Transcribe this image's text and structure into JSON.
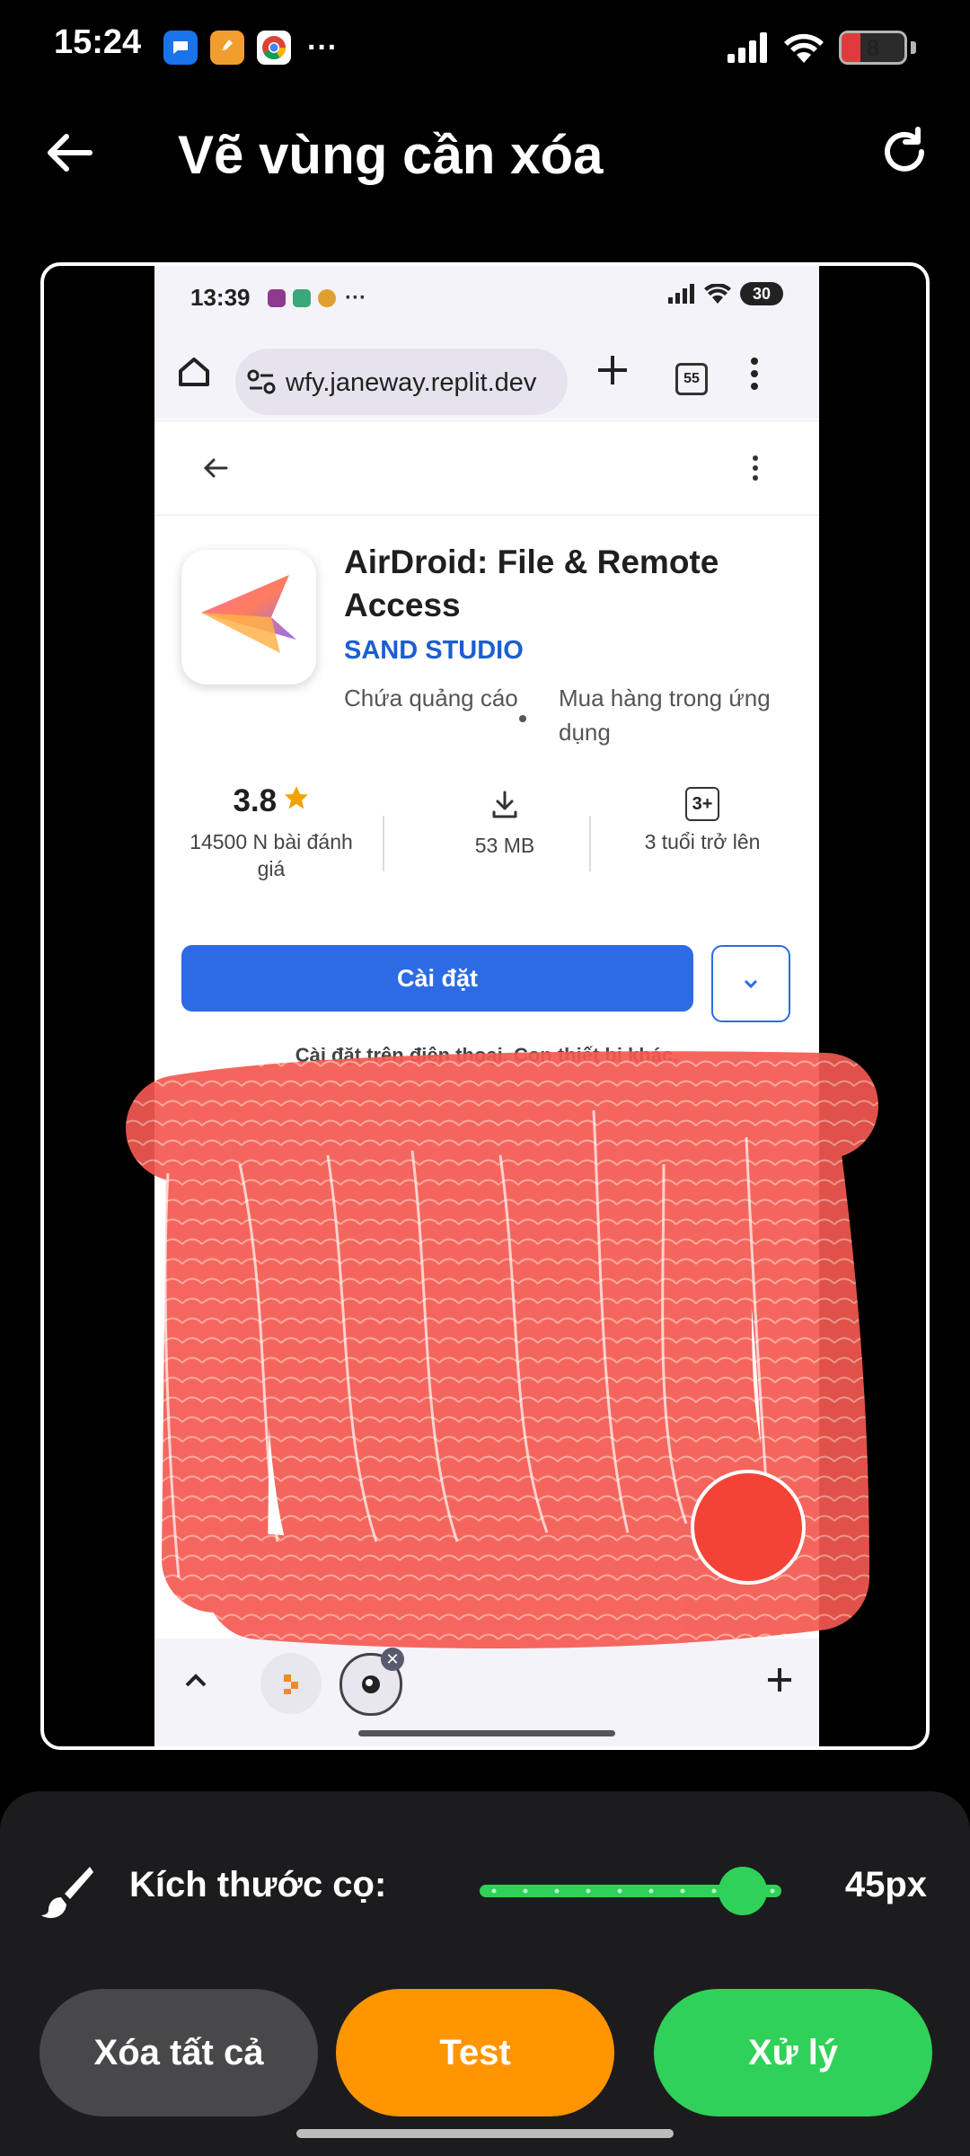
{
  "status_bar": {
    "time": "15:24",
    "battery": "8"
  },
  "header": {
    "title": "Vẽ vùng cần xóa"
  },
  "screenshot": {
    "status_time": "13:39",
    "status_battery": "30",
    "url": "wfy.janeway.replit.dev",
    "tab_count": "55",
    "app": {
      "name": "AirDroid: File & Remote Access",
      "developer": "SAND STUDIO",
      "tag_ads": "Chứa quảng cáo",
      "tag_iap": "Mua hàng trong ứng dụng",
      "rating": "3.8",
      "reviews": "14500 N bài đánh giá",
      "size": "53 MB",
      "age_badge": "3+",
      "age_label": "3 tuổi trở lên",
      "install_label": "Cài đặt",
      "install_note": "Cài đặt trên điện thoại. Con thiết bị khác."
    }
  },
  "brush": {
    "label": "Kích thước cọ:",
    "value": "45px",
    "level": 0.85
  },
  "actions": {
    "clear_label": "Xóa tất cả",
    "test_label": "Test",
    "process_label": "Xử lý"
  },
  "colors": {
    "accent_green": "#30d158",
    "accent_orange": "#ff9500",
    "mask_red": "#f45a50",
    "install_blue": "#2d6be5"
  }
}
